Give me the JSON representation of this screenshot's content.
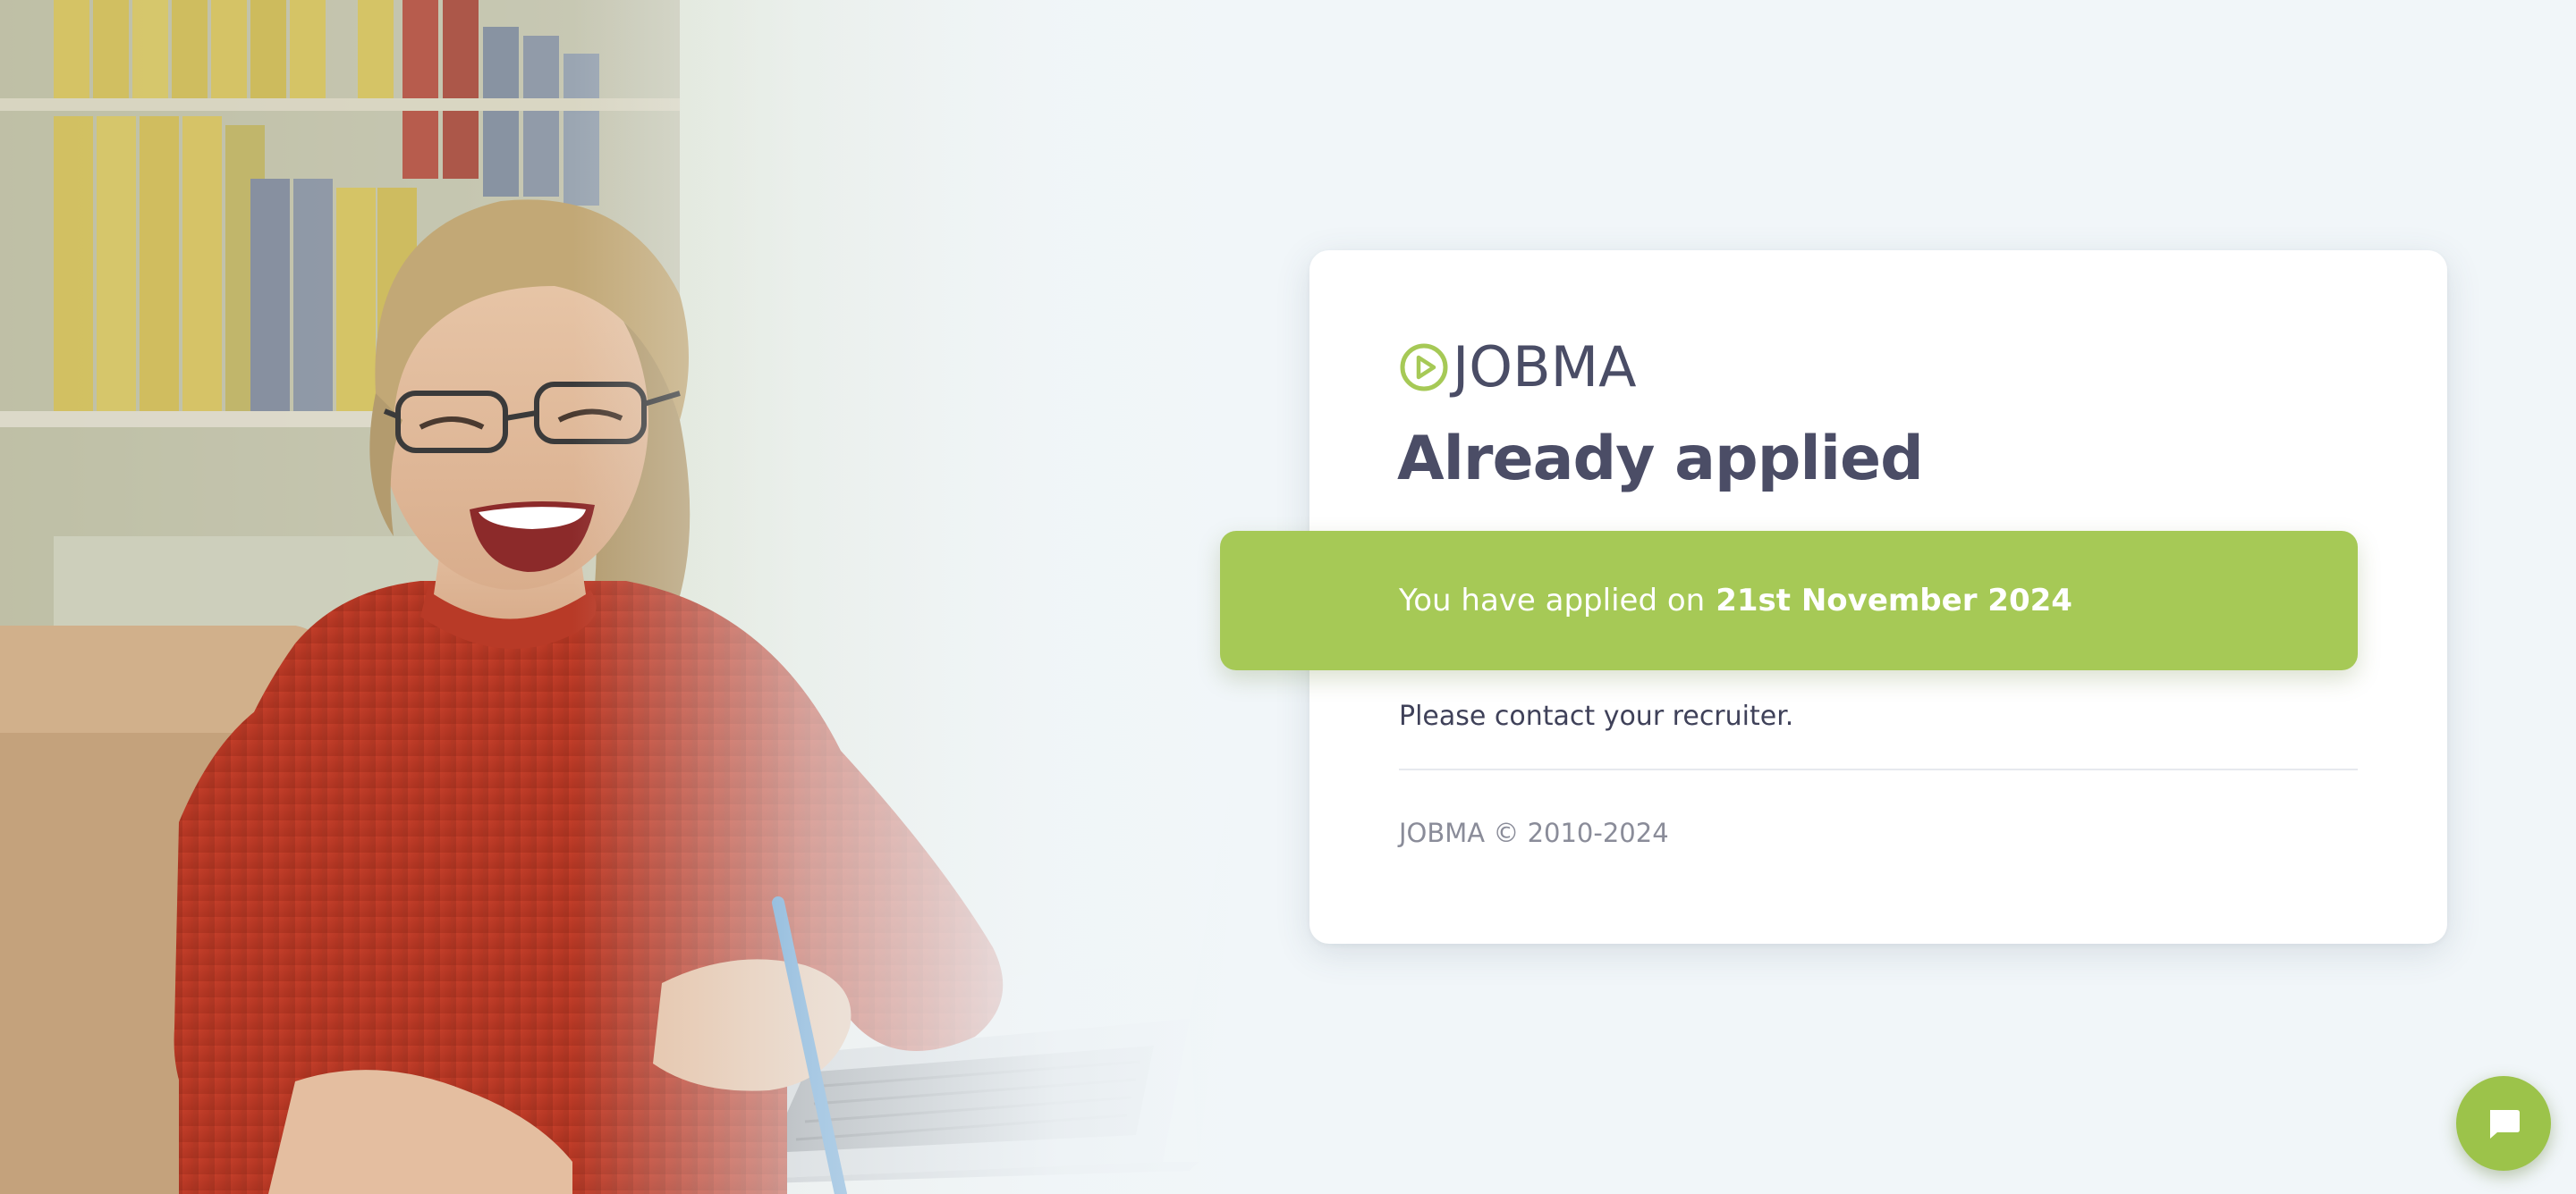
{
  "hero": {
    "image_description_icon": "photo-smiling-woman-laptop"
  },
  "card": {
    "logo": {
      "icon": "play-circle-icon",
      "text": "JOBMA"
    },
    "title": "Already applied",
    "banner": {
      "prefix": "You have applied on",
      "date": "21st November 2024"
    },
    "message": "Please contact your recruiter.",
    "footer": "JOBMA © 2010-2024"
  },
  "chat": {
    "icon": "chat-bubble-icon"
  },
  "colors": {
    "page_bg": "#f1f6f9",
    "accent_green": "#a6c956",
    "heading": "#4b4d66",
    "body_text": "#3f4159",
    "muted_text": "#8a8c99",
    "card_bg": "#ffffff"
  }
}
